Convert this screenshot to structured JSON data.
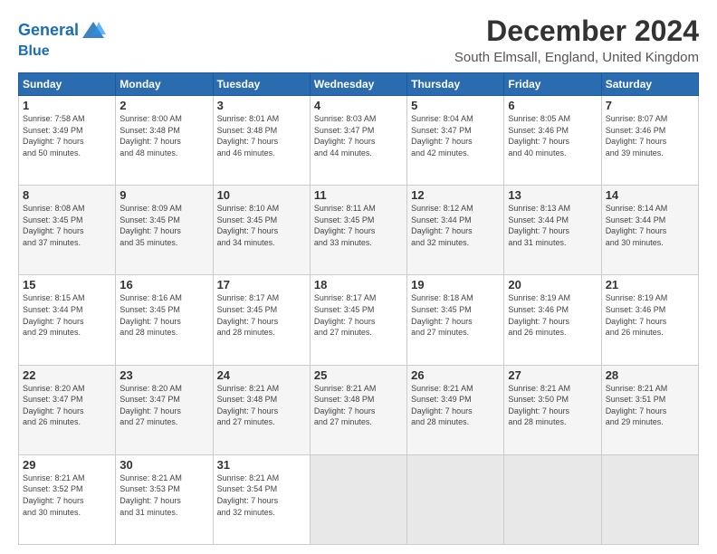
{
  "logo": {
    "line1": "General",
    "line2": "Blue"
  },
  "title": "December 2024",
  "subtitle": "South Elmsall, England, United Kingdom",
  "header_days": [
    "Sunday",
    "Monday",
    "Tuesday",
    "Wednesday",
    "Thursday",
    "Friday",
    "Saturday"
  ],
  "weeks": [
    [
      {
        "day": "1",
        "info": "Sunrise: 7:58 AM\nSunset: 3:49 PM\nDaylight: 7 hours\nand 50 minutes."
      },
      {
        "day": "2",
        "info": "Sunrise: 8:00 AM\nSunset: 3:48 PM\nDaylight: 7 hours\nand 48 minutes."
      },
      {
        "day": "3",
        "info": "Sunrise: 8:01 AM\nSunset: 3:48 PM\nDaylight: 7 hours\nand 46 minutes."
      },
      {
        "day": "4",
        "info": "Sunrise: 8:03 AM\nSunset: 3:47 PM\nDaylight: 7 hours\nand 44 minutes."
      },
      {
        "day": "5",
        "info": "Sunrise: 8:04 AM\nSunset: 3:47 PM\nDaylight: 7 hours\nand 42 minutes."
      },
      {
        "day": "6",
        "info": "Sunrise: 8:05 AM\nSunset: 3:46 PM\nDaylight: 7 hours\nand 40 minutes."
      },
      {
        "day": "7",
        "info": "Sunrise: 8:07 AM\nSunset: 3:46 PM\nDaylight: 7 hours\nand 39 minutes."
      }
    ],
    [
      {
        "day": "8",
        "info": "Sunrise: 8:08 AM\nSunset: 3:45 PM\nDaylight: 7 hours\nand 37 minutes."
      },
      {
        "day": "9",
        "info": "Sunrise: 8:09 AM\nSunset: 3:45 PM\nDaylight: 7 hours\nand 35 minutes."
      },
      {
        "day": "10",
        "info": "Sunrise: 8:10 AM\nSunset: 3:45 PM\nDaylight: 7 hours\nand 34 minutes."
      },
      {
        "day": "11",
        "info": "Sunrise: 8:11 AM\nSunset: 3:45 PM\nDaylight: 7 hours\nand 33 minutes."
      },
      {
        "day": "12",
        "info": "Sunrise: 8:12 AM\nSunset: 3:44 PM\nDaylight: 7 hours\nand 32 minutes."
      },
      {
        "day": "13",
        "info": "Sunrise: 8:13 AM\nSunset: 3:44 PM\nDaylight: 7 hours\nand 31 minutes."
      },
      {
        "day": "14",
        "info": "Sunrise: 8:14 AM\nSunset: 3:44 PM\nDaylight: 7 hours\nand 30 minutes."
      }
    ],
    [
      {
        "day": "15",
        "info": "Sunrise: 8:15 AM\nSunset: 3:44 PM\nDaylight: 7 hours\nand 29 minutes."
      },
      {
        "day": "16",
        "info": "Sunrise: 8:16 AM\nSunset: 3:45 PM\nDaylight: 7 hours\nand 28 minutes."
      },
      {
        "day": "17",
        "info": "Sunrise: 8:17 AM\nSunset: 3:45 PM\nDaylight: 7 hours\nand 28 minutes."
      },
      {
        "day": "18",
        "info": "Sunrise: 8:17 AM\nSunset: 3:45 PM\nDaylight: 7 hours\nand 27 minutes."
      },
      {
        "day": "19",
        "info": "Sunrise: 8:18 AM\nSunset: 3:45 PM\nDaylight: 7 hours\nand 27 minutes."
      },
      {
        "day": "20",
        "info": "Sunrise: 8:19 AM\nSunset: 3:46 PM\nDaylight: 7 hours\nand 26 minutes."
      },
      {
        "day": "21",
        "info": "Sunrise: 8:19 AM\nSunset: 3:46 PM\nDaylight: 7 hours\nand 26 minutes."
      }
    ],
    [
      {
        "day": "22",
        "info": "Sunrise: 8:20 AM\nSunset: 3:47 PM\nDaylight: 7 hours\nand 26 minutes."
      },
      {
        "day": "23",
        "info": "Sunrise: 8:20 AM\nSunset: 3:47 PM\nDaylight: 7 hours\nand 27 minutes."
      },
      {
        "day": "24",
        "info": "Sunrise: 8:21 AM\nSunset: 3:48 PM\nDaylight: 7 hours\nand 27 minutes."
      },
      {
        "day": "25",
        "info": "Sunrise: 8:21 AM\nSunset: 3:48 PM\nDaylight: 7 hours\nand 27 minutes."
      },
      {
        "day": "26",
        "info": "Sunrise: 8:21 AM\nSunset: 3:49 PM\nDaylight: 7 hours\nand 28 minutes."
      },
      {
        "day": "27",
        "info": "Sunrise: 8:21 AM\nSunset: 3:50 PM\nDaylight: 7 hours\nand 28 minutes."
      },
      {
        "day": "28",
        "info": "Sunrise: 8:21 AM\nSunset: 3:51 PM\nDaylight: 7 hours\nand 29 minutes."
      }
    ],
    [
      {
        "day": "29",
        "info": "Sunrise: 8:21 AM\nSunset: 3:52 PM\nDaylight: 7 hours\nand 30 minutes."
      },
      {
        "day": "30",
        "info": "Sunrise: 8:21 AM\nSunset: 3:53 PM\nDaylight: 7 hours\nand 31 minutes."
      },
      {
        "day": "31",
        "info": "Sunrise: 8:21 AM\nSunset: 3:54 PM\nDaylight: 7 hours\nand 32 minutes."
      },
      {
        "day": "",
        "info": ""
      },
      {
        "day": "",
        "info": ""
      },
      {
        "day": "",
        "info": ""
      },
      {
        "day": "",
        "info": ""
      }
    ]
  ]
}
